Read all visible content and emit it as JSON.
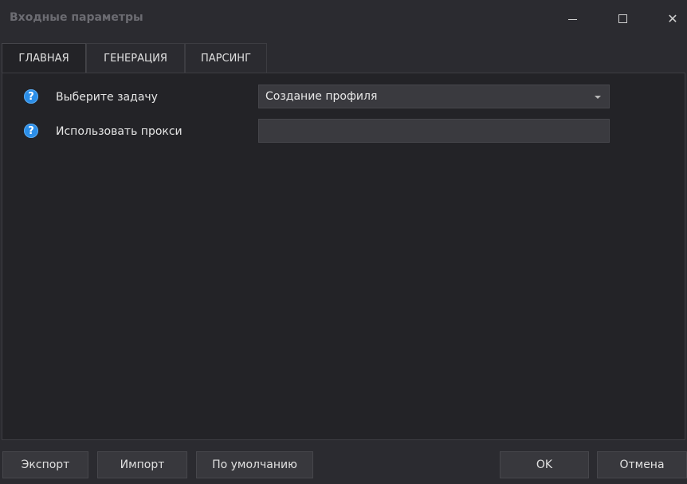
{
  "window": {
    "title": "Входные параметры",
    "controls": {
      "minimize": "minimize-icon",
      "maximize": "maximize-icon",
      "close": "close-icon"
    }
  },
  "tabs": [
    {
      "label": "ГЛАВНАЯ",
      "active": true
    },
    {
      "label": "ГЕНЕРАЦИЯ",
      "active": false
    },
    {
      "label": "ПАРСИНГ",
      "active": false
    }
  ],
  "fields": [
    {
      "label": "Выберите задачу",
      "type": "select",
      "value": "Создание профиля",
      "help_icon": "?"
    },
    {
      "label": "Использовать прокси",
      "type": "text",
      "value": "",
      "help_icon": "?"
    }
  ],
  "footer": {
    "export": "Экспорт",
    "import": "Импорт",
    "default": "По умолчанию",
    "ok": "OK",
    "cancel": "Отмена"
  },
  "colors": {
    "background": "#2b2b30",
    "panel": "#232327",
    "input": "#3a3a3f",
    "help_icon": "#2b8ee8"
  }
}
